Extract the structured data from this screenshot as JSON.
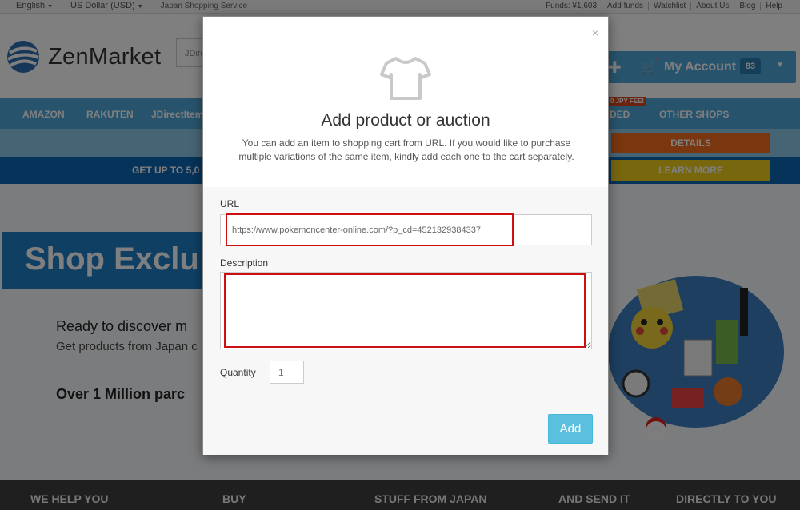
{
  "topbar": {
    "language": "English",
    "currency": "US Dollar (USD)",
    "service": "Japan Shopping Service",
    "links": [
      "Funds: ¥1,603",
      "Add funds",
      "Watchlist",
      "About Us",
      "Blog",
      "Help"
    ]
  },
  "header": {
    "brand": "ZenMarket",
    "search_stub": "JDire",
    "account_label": "My Account",
    "cart_count": "83"
  },
  "nav": {
    "items": [
      "AMAZON",
      "RAKUTEN",
      "JDirectItem",
      "DED",
      "OTHER SHOPS"
    ],
    "promo_tag": "0 JPY FEE!"
  },
  "promo": {
    "band_text": "GET UP TO 5,0",
    "details_label": "DETAILS",
    "learn_more_label": "LEARN MORE"
  },
  "hero": {
    "banner": "Shop Exclu",
    "heading": "Ready to discover m",
    "subheading": "Get products from Japan c",
    "stat": "Over 1 Million parc"
  },
  "footer": {
    "items": [
      "WE HELP YOU",
      "BUY",
      "STUFF FROM JAPAN",
      "AND SEND IT",
      "DIRECTLY TO YOU"
    ]
  },
  "modal": {
    "close_label": "×",
    "title": "Add product or auction",
    "description": "You can add an item to shopping cart from URL. If you would like to purchase multiple variations of the same item, kindly add each one to the cart separately.",
    "url_label": "URL",
    "url_value": "https://www.pokemoncenter-online.com/?p_cd=4521329384337",
    "description_label": "Description",
    "description_value": "",
    "quantity_label": "Quantity",
    "quantity_placeholder": "1",
    "add_label": "Add"
  },
  "colors": {
    "brand_blue": "#4fa9d9",
    "dark_blue": "#0d66b3",
    "orange": "#f26c1f",
    "yellow": "#f2cf1a",
    "add_button": "#5bc0de",
    "highlight_red": "#cc1010"
  }
}
